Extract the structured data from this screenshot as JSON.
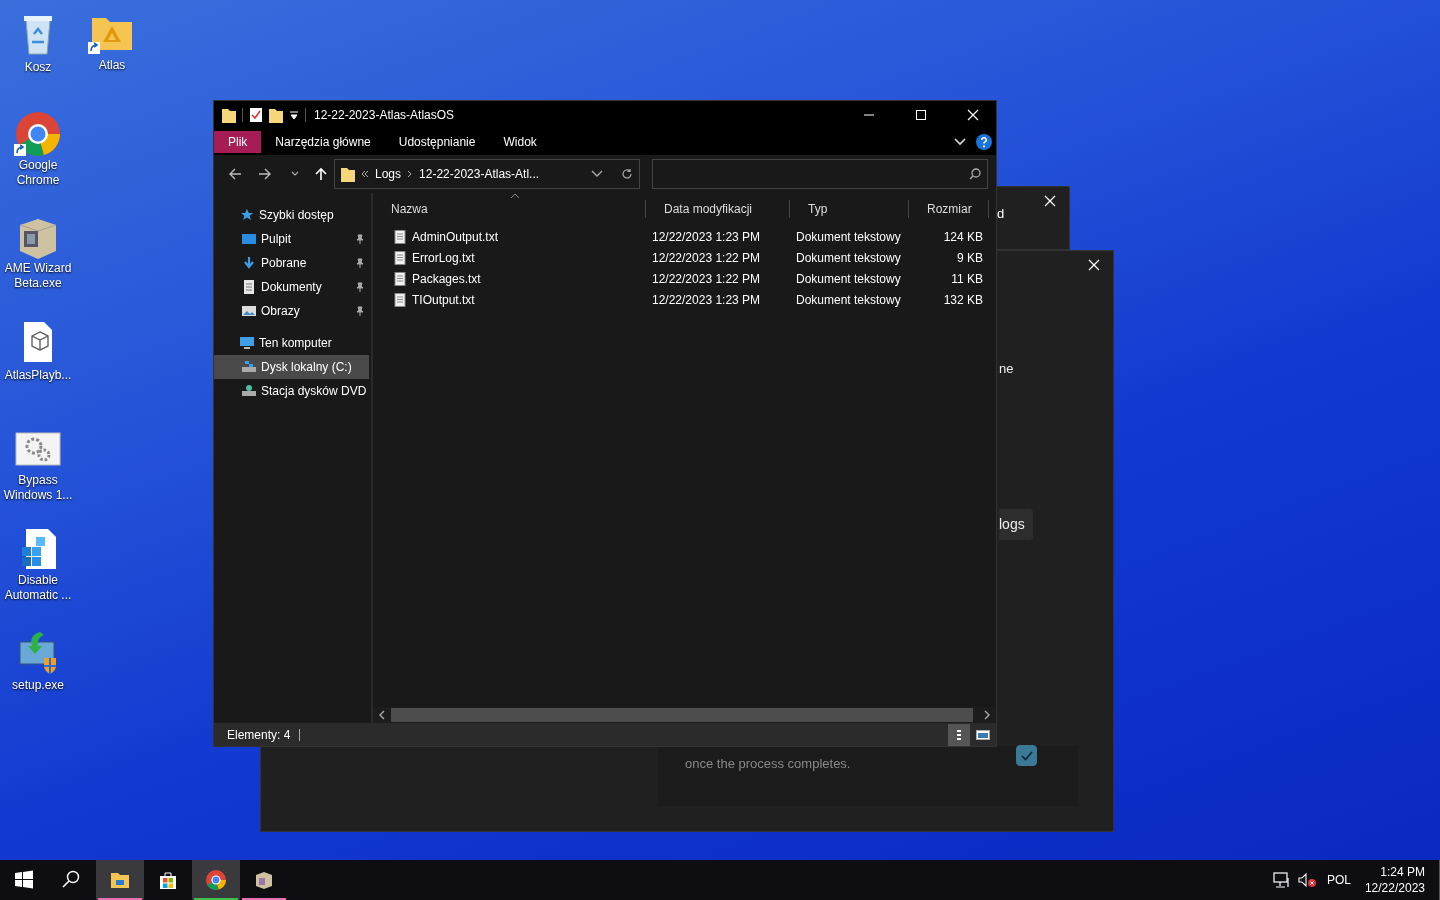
{
  "desktop_icons": [
    {
      "label": "Kosz",
      "kind": "recycle-bin",
      "shortcut": false
    },
    {
      "label": "Atlas",
      "kind": "folder",
      "shortcut": true
    },
    {
      "label": "Google Chrome",
      "kind": "chrome",
      "shortcut": true
    },
    {
      "label": "AME Wizard Beta.exe",
      "kind": "ame",
      "shortcut": false
    },
    {
      "label": "AtlasPlayb...",
      "kind": "playbook",
      "shortcut": false
    },
    {
      "label": "Bypass Windows 1...",
      "kind": "gears",
      "shortcut": false
    },
    {
      "label": "Disable Automatic ...",
      "kind": "registry",
      "shortcut": false
    },
    {
      "label": "setup.exe",
      "kind": "setup",
      "shortcut": false
    }
  ],
  "background_windows": [
    {
      "kind": "small",
      "texts": [
        "d"
      ]
    },
    {
      "kind": "dialog",
      "texts": [
        "ne"
      ],
      "button": "logs",
      "note": "once the process completes.",
      "checked": true
    }
  ],
  "explorer": {
    "title": "12-22-2023-Atlas-AtlasOS",
    "ribbon_tabs": [
      {
        "label": "Plik",
        "selected": true
      },
      {
        "label": "Narzędzia główne",
        "selected": false
      },
      {
        "label": "Udostępnianie",
        "selected": false
      },
      {
        "label": "Widok",
        "selected": false
      }
    ],
    "breadcrumb": [
      "Logs",
      "12-22-2023-Atlas-Atl..."
    ],
    "nav": [
      {
        "label": "Szybki dostęp",
        "kind": "star",
        "selected": false,
        "children": [
          {
            "label": "Pulpit",
            "kind": "desktop",
            "pinned": true,
            "selected": false
          },
          {
            "label": "Pobrane",
            "kind": "download",
            "pinned": true,
            "selected": false
          },
          {
            "label": "Dokumenty",
            "kind": "document",
            "pinned": true,
            "selected": false
          },
          {
            "label": "Obrazy",
            "kind": "pictures",
            "pinned": true,
            "selected": false
          }
        ]
      },
      {
        "label": "Ten komputer",
        "kind": "pc",
        "selected": false,
        "children": [
          {
            "label": "Dysk lokalny (C:)",
            "kind": "drive",
            "pinned": false,
            "selected": true
          },
          {
            "label": "Stacja dysków DVD",
            "kind": "dvd",
            "pinned": false,
            "selected": false
          }
        ]
      }
    ],
    "columns": [
      "Nazwa",
      "Data modyfikacji",
      "Typ",
      "Rozmiar"
    ],
    "rows": [
      {
        "name": "AdminOutput.txt",
        "modified": "12/22/2023 1:23 PM",
        "type": "Dokument tekstowy",
        "size": "124 KB"
      },
      {
        "name": "ErrorLog.txt",
        "modified": "12/22/2023 1:22 PM",
        "type": "Dokument tekstowy",
        "size": "9 KB"
      },
      {
        "name": "Packages.txt",
        "modified": "12/22/2023 1:22 PM",
        "type": "Dokument tekstowy",
        "size": "11 KB"
      },
      {
        "name": "TIOutput.txt",
        "modified": "12/22/2023 1:23 PM",
        "type": "Dokument tekstowy",
        "size": "132 KB"
      }
    ],
    "status": "Elementy: 4"
  },
  "taskbar": {
    "items": [
      {
        "kind": "start",
        "selected": false
      },
      {
        "kind": "search",
        "selected": false
      },
      {
        "kind": "explorer",
        "selected": true,
        "color": "#e86fb4"
      },
      {
        "kind": "store",
        "selected": false
      },
      {
        "kind": "chrome",
        "selected": true,
        "color": "#3ec24a"
      },
      {
        "kind": "ame",
        "selected": false,
        "color": "#e86fb4"
      }
    ],
    "language": "POL",
    "time": "1:24 PM",
    "date": "12/22/2023"
  }
}
